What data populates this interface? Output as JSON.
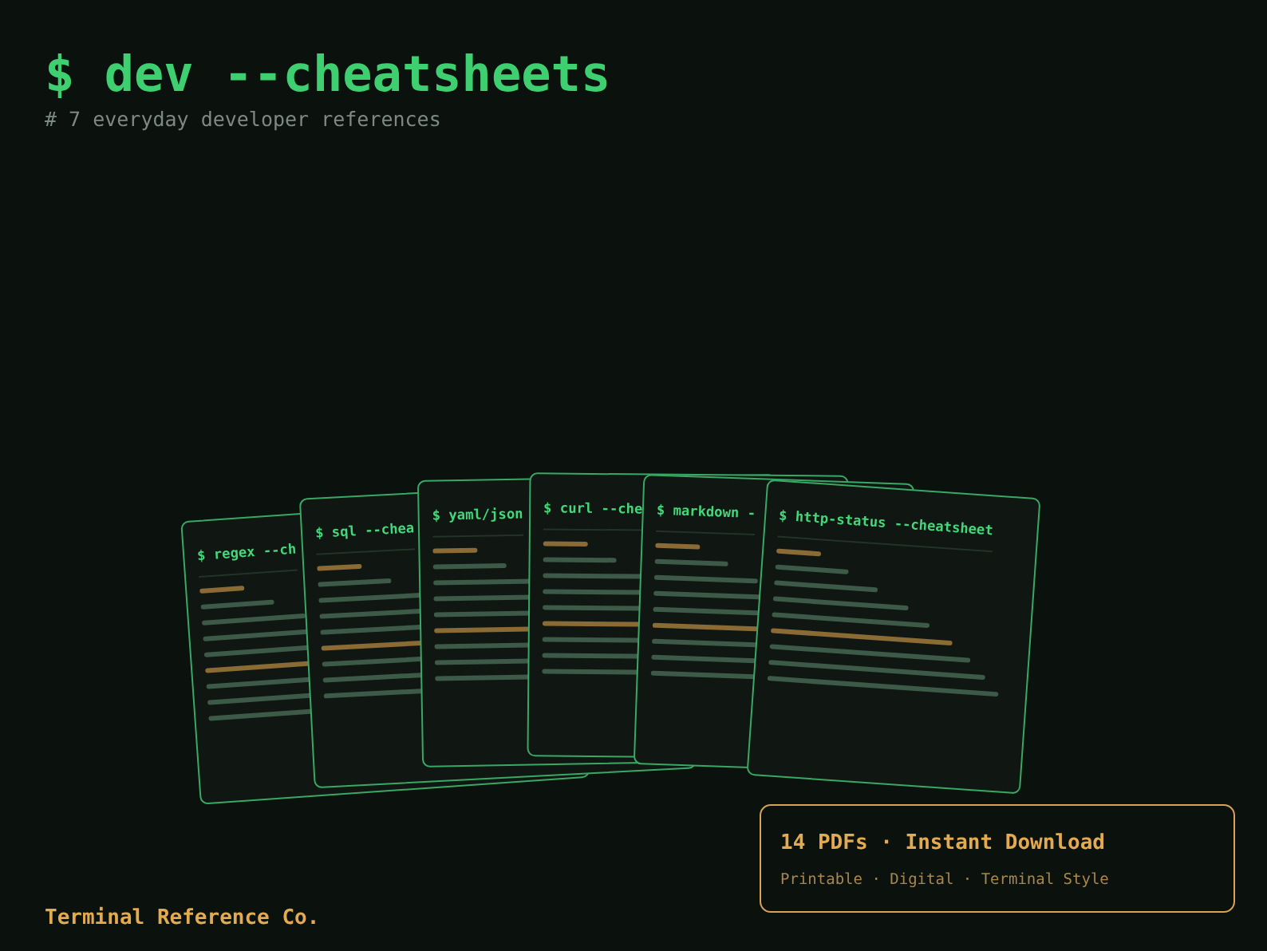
{
  "header": {
    "title": "$ dev --cheatsheets",
    "subtitle": "# 7 everyday developer references"
  },
  "cards": [
    {
      "title": "$ regex --ch"
    },
    {
      "title": "$ sql --chea"
    },
    {
      "title": "$ yaml/json"
    },
    {
      "title": "$ curl --che"
    },
    {
      "title": "$ markdown -"
    },
    {
      "title": "$ http-status --cheatsheet"
    }
  ],
  "offer": {
    "headline": "14 PDFs · Instant Download",
    "details": "Printable · Digital · Terminal Style"
  },
  "brand": "Terminal Reference Co."
}
